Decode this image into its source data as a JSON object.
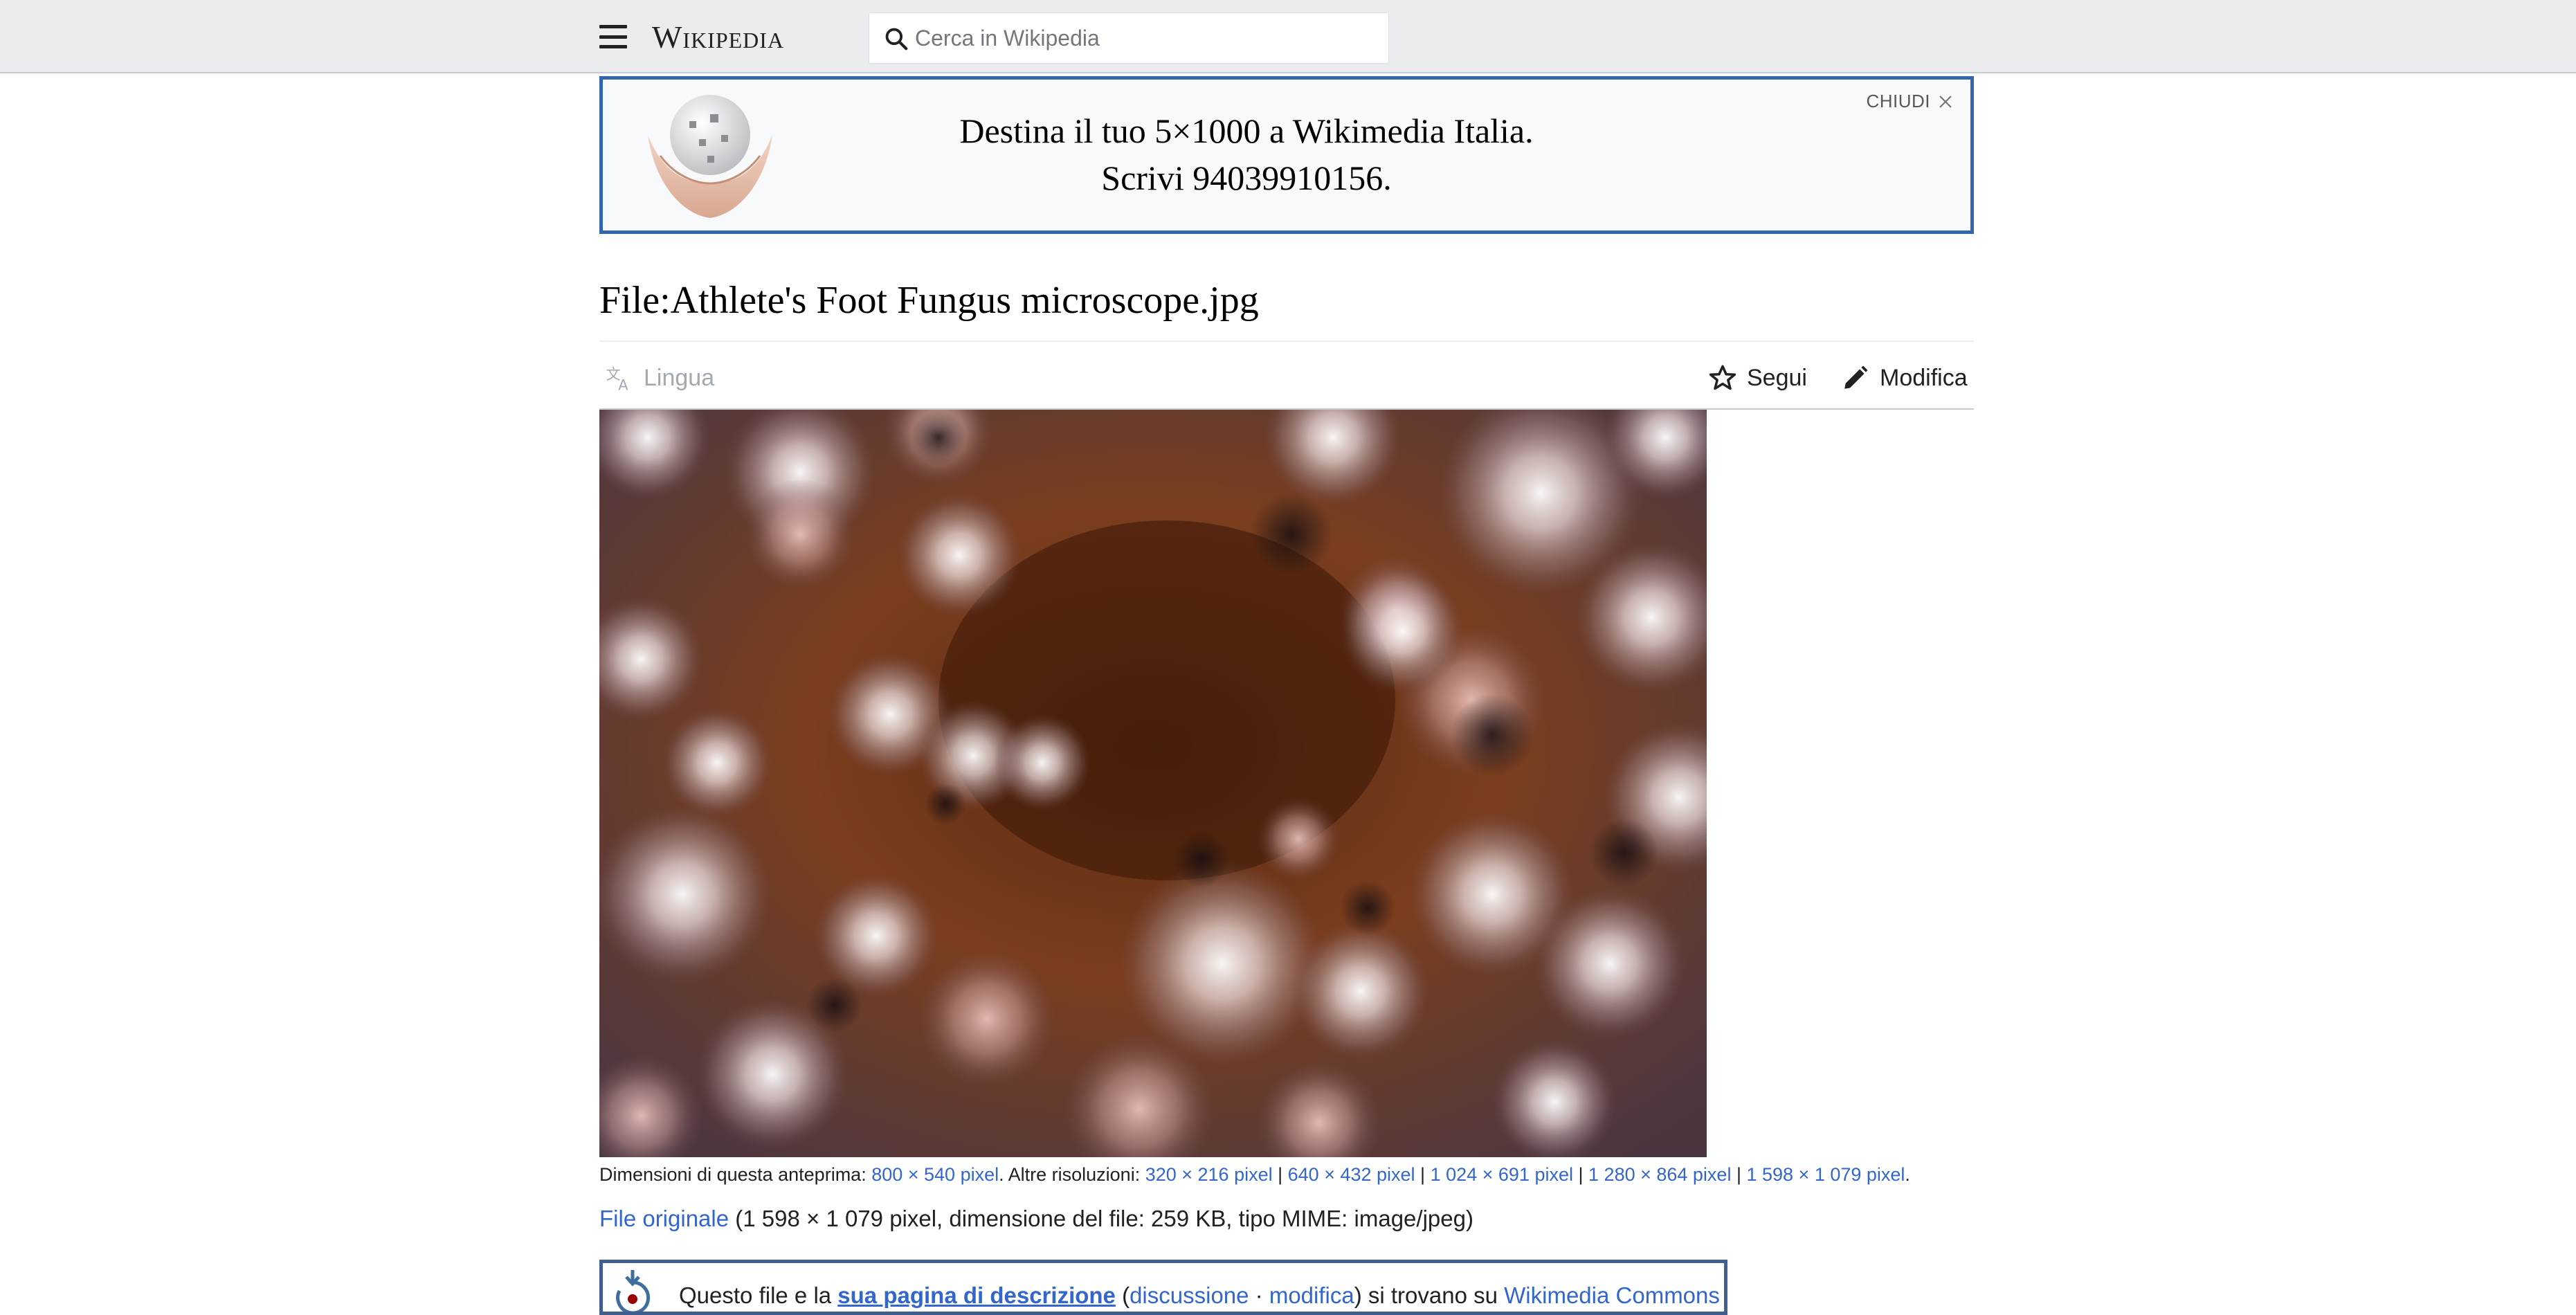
{
  "header": {
    "wordmark": "Wikipedia",
    "search": {
      "placeholder": "Cerca in Wikipedia",
      "value": ""
    }
  },
  "banner": {
    "line1": "Destina il tuo 5×1000 a Wikimedia Italia.",
    "line2": "Scrivi 94039910156.",
    "close_label": "CHIUDI"
  },
  "page": {
    "title": "File:Athlete's Foot Fungus microscope.jpg"
  },
  "toolbar": {
    "language_label": "Lingua",
    "follow_label": "Segui",
    "edit_label": "Modifica"
  },
  "file_info": {
    "preview_prefix": "Dimensioni di questa anteprima: ",
    "preview_size": "800 × 540 pixel",
    "other_prefix": ". Altre risoluzioni: ",
    "resolutions": [
      "320 × 216 pixel",
      "640 × 432 pixel",
      "1 024 × 691 pixel",
      "1 280 × 864 pixel",
      "1 598 × 1 079 pixel"
    ],
    "separator": " | ",
    "end": ".",
    "original_link": "File originale",
    "original_details": " (1 598 × 1 079 pixel, dimensione del file: 259 KB, tipo MIME: image/jpeg)"
  },
  "commons_notice": {
    "text_start": "Questo file e la ",
    "description_link": "sua pagina di descrizione",
    "text_paren_open": " (",
    "discussion_link": "discussione",
    "sep": " · ",
    "edit_link": "modifica",
    "text_mid": ") si trovano su ",
    "commons_link": "Wikimedia Commons",
    "help_link": " (?)"
  },
  "colors": {
    "header_bg": "#eaecf0",
    "banner_border": "#3366aa",
    "link": "#3366cc"
  }
}
